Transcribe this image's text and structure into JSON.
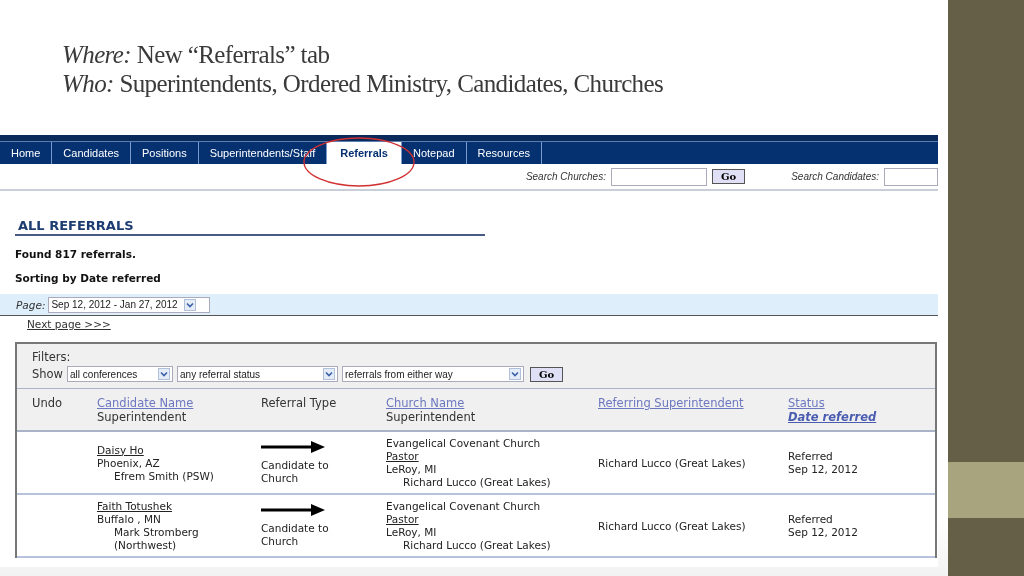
{
  "slide": {
    "title_lines": [
      "*Where:*  New “Referrals” tab",
      "*Who:*  Superintendents, Ordered Ministry, Candidates, Churches"
    ]
  },
  "nav": {
    "tabs": [
      {
        "label": "Home",
        "selected": false
      },
      {
        "label": "Candidates",
        "selected": false
      },
      {
        "label": "Positions",
        "selected": false
      },
      {
        "label": "Superintendents/Staff",
        "selected": false
      },
      {
        "label": "Referrals",
        "selected": true
      },
      {
        "label": "Notepad",
        "selected": false
      },
      {
        "label": "Resources",
        "selected": false
      }
    ]
  },
  "search": [
    {
      "label": "Search Churches:",
      "button": "Go"
    },
    {
      "label": "Search Candidates:"
    }
  ],
  "heading": "ALL REFERRALS",
  "found": "Found 817 referrals.",
  "sorting": "Sorting by Date referred",
  "page_selector": {
    "label": "Page:",
    "value": "Sep 12, 2012 - Jan 27, 2012"
  },
  "next_page": "Next page >>>",
  "filters": {
    "label": "Filters:",
    "show_label": "Show",
    "selects": [
      "all conferences",
      "any referral status",
      "referrals from either way"
    ],
    "button": "Go"
  },
  "table": {
    "columns": [
      {
        "lines": [
          {
            "text": "Undo",
            "kind": "plain"
          }
        ]
      },
      {
        "lines": [
          {
            "text": "Candidate Name",
            "kind": "link"
          },
          {
            "text": "Superintendent",
            "kind": "plain"
          }
        ]
      },
      {
        "lines": [
          {
            "text": "Referral Type",
            "kind": "plain"
          }
        ]
      },
      {
        "lines": [
          {
            "text": "Church Name",
            "kind": "link"
          },
          {
            "text": "Superintendent",
            "kind": "plain"
          }
        ]
      },
      {
        "lines": [
          {
            "text": "Referring Superintendent",
            "kind": "link"
          }
        ]
      },
      {
        "lines": [
          {
            "text": "Status",
            "kind": "link"
          },
          {
            "text": "Date referred",
            "kind": "sort-link"
          }
        ]
      }
    ],
    "rows": [
      {
        "candidate": {
          "name": "Daisy Ho",
          "location": "Phoenix, AZ",
          "superintendent": "Efrem Smith (PSW)"
        },
        "referral_type": "Candidate to Church",
        "church": {
          "name": "Evangelical Covenant Church",
          "role": "Pastor",
          "location": "LeRoy, MI",
          "superintendent": "Richard Lucco (Great Lakes)"
        },
        "referring_superintendent": "Richard Lucco (Great Lakes)",
        "status": "Referred",
        "date": "Sep 12, 2012"
      },
      {
        "candidate": {
          "name": "Faith Totushek",
          "location": "Buffalo , MN",
          "superintendent": "Mark Stromberg (Northwest)"
        },
        "referral_type": "Candidate to Church",
        "church": {
          "name": "Evangelical Covenant Church",
          "role": "Pastor",
          "location": "LeRoy, MI",
          "superintendent": "Richard Lucco (Great Lakes)"
        },
        "referring_superintendent": "Richard Lucco (Great Lakes)",
        "status": "Referred",
        "date": "Sep 12, 2012"
      }
    ]
  }
}
